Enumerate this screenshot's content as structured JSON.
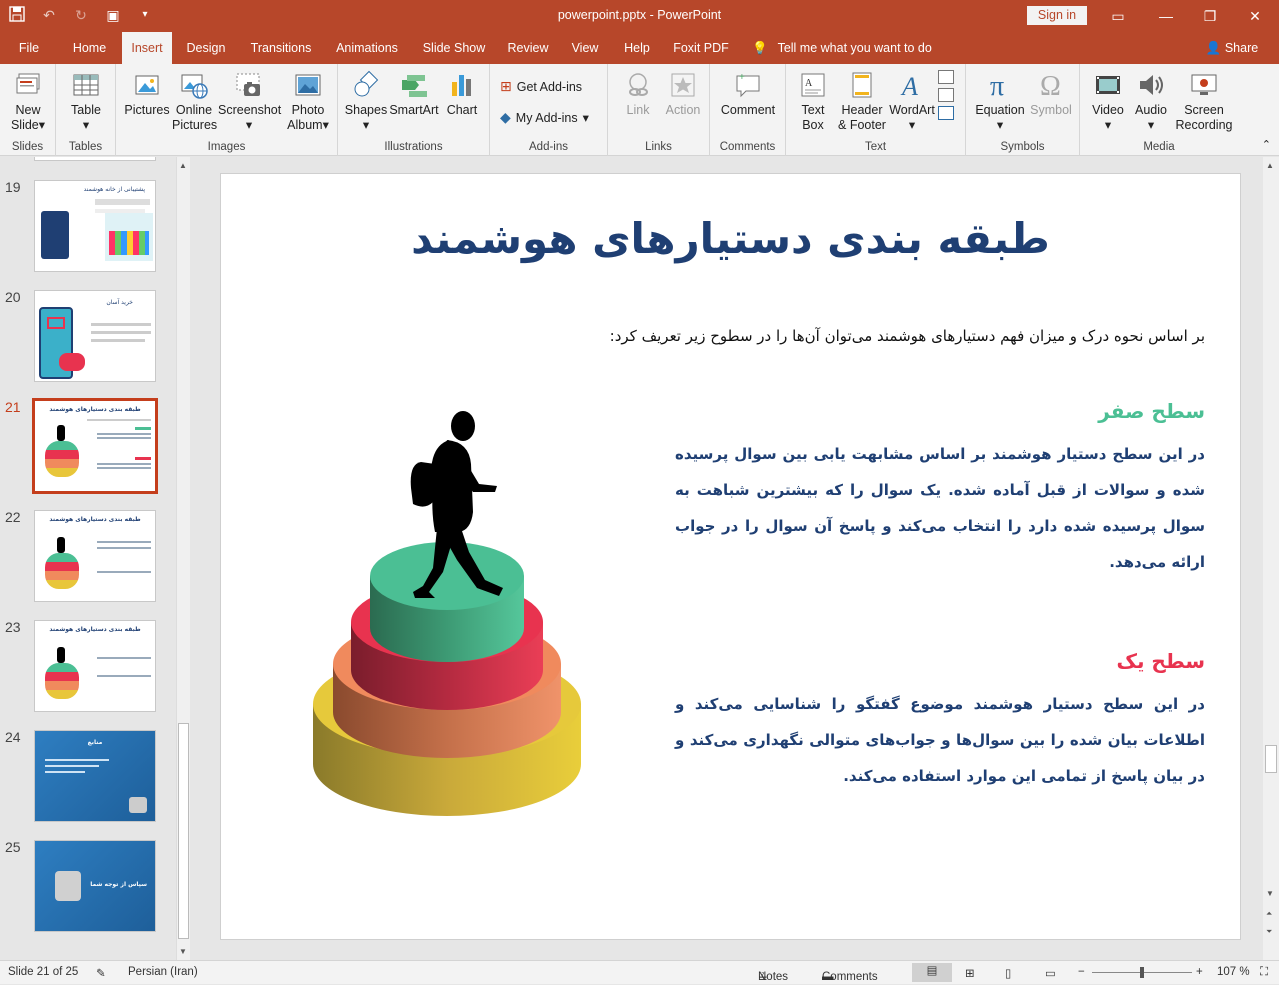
{
  "window": {
    "title": "powerpoint.pptx  -  PowerPoint",
    "sign_in": "Sign in"
  },
  "menu": {
    "tabs": [
      "File",
      "Home",
      "Insert",
      "Design",
      "Transitions",
      "Animations",
      "Slide Show",
      "Review",
      "View",
      "Help",
      "Foxit PDF"
    ],
    "active_tab": "Insert",
    "tell_me": "Tell me what you want to do",
    "share": "Share"
  },
  "ribbon": {
    "groups": {
      "slides": "Slides",
      "tables": "Tables",
      "images": "Images",
      "illustrations": "Illustrations",
      "addins": "Add-ins",
      "links": "Links",
      "comments": "Comments",
      "text": "Text",
      "symbols": "Symbols",
      "media": "Media"
    },
    "buttons": {
      "new_slide_1": "New",
      "new_slide_2": "Slide",
      "table": "Table",
      "pictures": "Pictures",
      "online_pictures_1": "Online",
      "online_pictures_2": "Pictures",
      "screenshot": "Screenshot",
      "photo_album_1": "Photo",
      "photo_album_2": "Album",
      "shapes": "Shapes",
      "smartart": "SmartArt",
      "chart": "Chart",
      "get_addins": "Get Add-ins",
      "my_addins": "My Add-ins",
      "link": "Link",
      "action": "Action",
      "comment": "Comment",
      "text_box_1": "Text",
      "text_box_2": "Box",
      "header_footer_1": "Header",
      "header_footer_2": "& Footer",
      "wordart": "WordArt",
      "equation": "Equation",
      "symbol": "Symbol",
      "video": "Video",
      "audio": "Audio",
      "screen_recording_1": "Screen",
      "screen_recording_2": "Recording"
    }
  },
  "thumbnails": [
    {
      "number": "19",
      "title": "پشتیبانی از خانه هوشمند"
    },
    {
      "number": "20",
      "title": "خرید آسان"
    },
    {
      "number": "21",
      "title": "طبقه بندی دستیارهای هوشمند",
      "selected": true
    },
    {
      "number": "22",
      "title": "طبقه بندی دستیارهای هوشمند"
    },
    {
      "number": "23",
      "title": "طبقه بندی دستیارهای هوشمند"
    },
    {
      "number": "24",
      "title": "منابع"
    },
    {
      "number": "25",
      "title": "سپاس از توجه شما"
    }
  ],
  "slide": {
    "title": "طبقه بندی دستیارهای هوشمند",
    "intro": "بر اساس نحوه درک و میزان فهم دستیارهای هوشمند می‌توان آن‌ها را در سطوح زیر تعریف کرد:",
    "level0_title": "سطح صفر",
    "level0_body": "در این سطح دستیار هوشمند بر اساس مشابهت یابی بین سوال پرسیده شده و سوالات از قبل آماده شده. یک سوال را که بیشترین شباهت به سوال پرسیده شده دارد را انتخاب می‌کند و پاسخ آن سوال را در جواب ارائه می‌دهد.",
    "level1_title": "سطح یک",
    "level1_body": "در این سطح دستیار هوشمند موضوع گفتگو را شناسایی می‌کند و اطلاعات بیان شده را بین سوال‌ها و جواب‌های متوالی نگهداری می‌کند و در بیان پاسخ از تمامی این موارد استفاده می‌کند.",
    "colors": {
      "title": "#1f3f73",
      "level0": "#4bbf94",
      "level1": "#e8334f",
      "body": "#1f3f73"
    }
  },
  "status": {
    "slide_counter": "Slide 21 of 25",
    "language": "Persian (Iran)",
    "notes": "Notes",
    "comments": "Comments",
    "zoom": "107 %"
  }
}
